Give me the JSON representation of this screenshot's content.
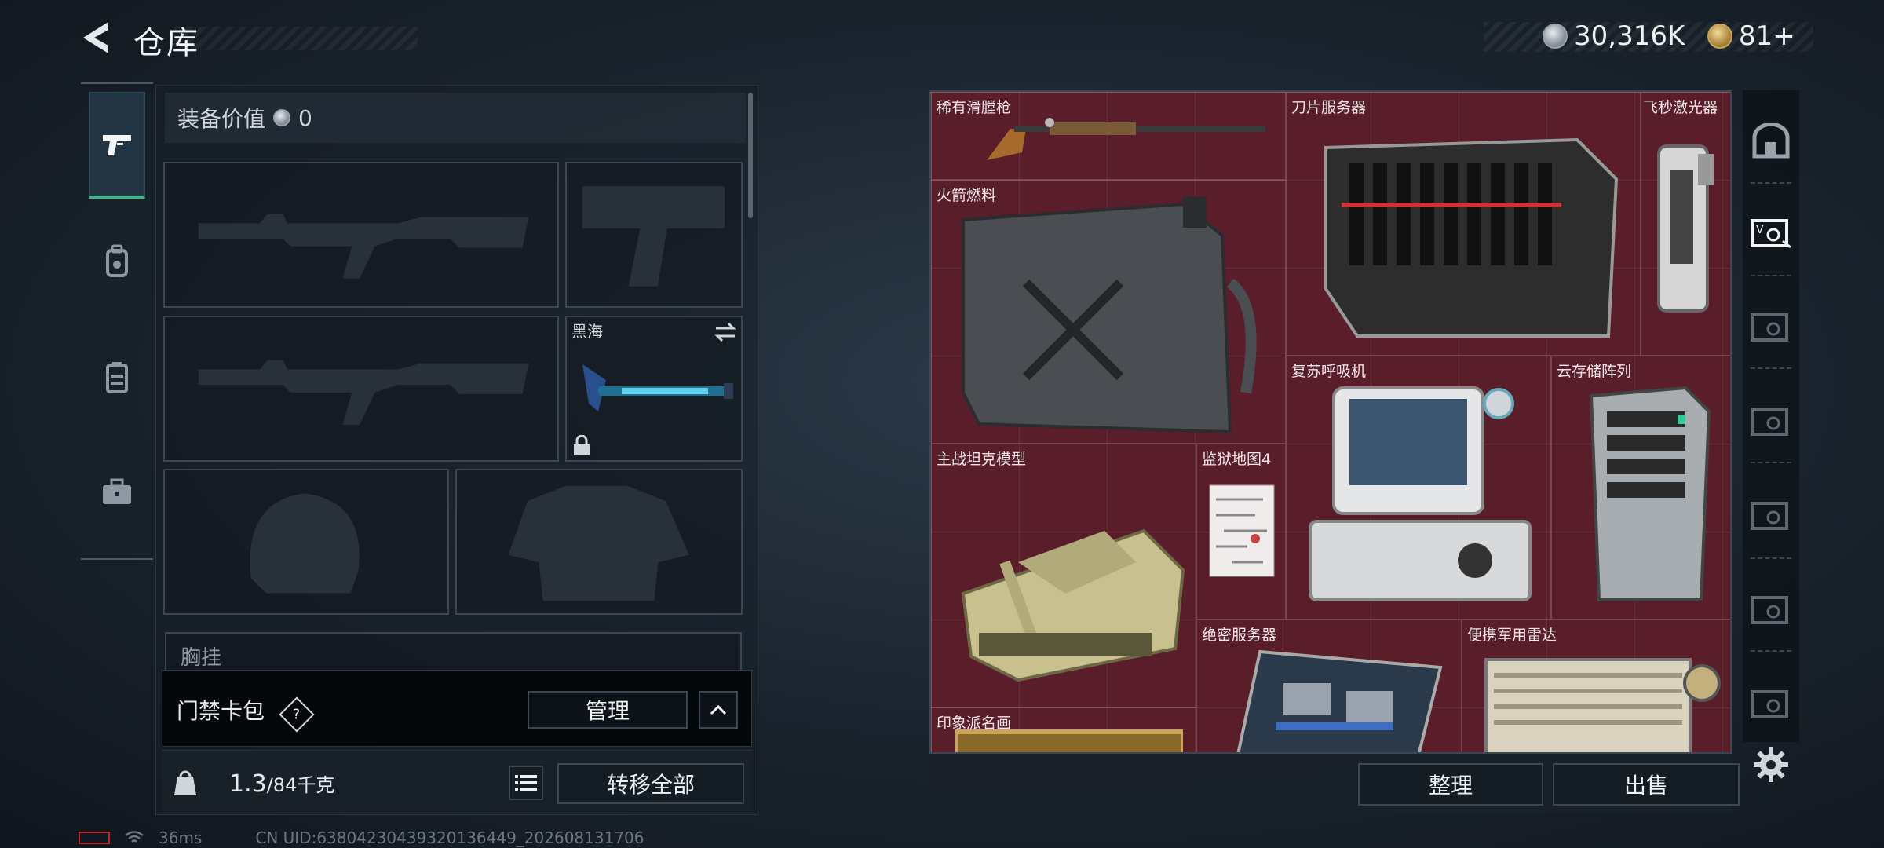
{
  "header": {
    "title": "仓库",
    "currency_silver": "30,316K",
    "currency_gold": "81+"
  },
  "equipment": {
    "value_label": "装备价值",
    "value": "0",
    "melee_slot_label": "黑海",
    "partial_row_label": "胸挂",
    "partial_row_help": "?"
  },
  "keycard": {
    "label": "门禁卡包",
    "help": "?",
    "manage_button": "管理"
  },
  "bottom": {
    "weight_current": "1.3",
    "weight_max": "/84千克",
    "transfer_all_button": "转移全部"
  },
  "items": [
    {
      "name": "稀有滑膛枪"
    },
    {
      "name": "刀片服务器"
    },
    {
      "name": "飞秒激光器"
    },
    {
      "name": "火箭燃料"
    },
    {
      "name": "复苏呼吸机"
    },
    {
      "name": "云存储阵列"
    },
    {
      "name": "主战坦克模型"
    },
    {
      "name": "监狱地图4"
    },
    {
      "name": "绝密服务器"
    },
    {
      "name": "便携军用雷达"
    },
    {
      "name": "印象派名画"
    }
  ],
  "grid_footer": {
    "sort_button": "整理",
    "sell_button": "出售"
  },
  "status_bar": {
    "ping": "36ms",
    "uid": "CN UID:63804230439320136449_202608131706"
  },
  "colors": {
    "grid_background": "#5a1e2a",
    "active_tab_accent": "#3fb58a",
    "battery_low": "#c0282b"
  }
}
